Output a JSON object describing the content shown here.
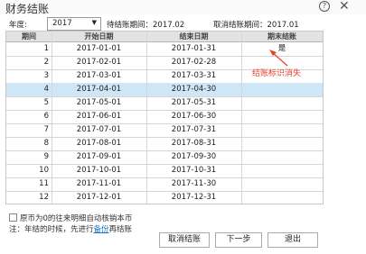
{
  "window": {
    "title": "财务结账"
  },
  "filter": {
    "year_label": "年度:",
    "year_value": "2017",
    "pending_label": "待结账期间：2017.02",
    "cancel_label": "取消结账期间：2017.01"
  },
  "table": {
    "columns": [
      "期间",
      "开始日期",
      "结束日期",
      "期末结账"
    ],
    "rows": [
      {
        "period": "1",
        "start": "2017-01-01",
        "end": "2017-01-31",
        "closed": "是"
      },
      {
        "period": "2",
        "start": "2017-02-01",
        "end": "2017-02-28",
        "closed": ""
      },
      {
        "period": "3",
        "start": "2017-03-01",
        "end": "2017-03-31",
        "closed": ""
      },
      {
        "period": "4",
        "start": "2017-04-01",
        "end": "2017-04-30",
        "closed": ""
      },
      {
        "period": "5",
        "start": "2017-05-01",
        "end": "2017-05-31",
        "closed": ""
      },
      {
        "period": "6",
        "start": "2017-06-01",
        "end": "2017-06-30",
        "closed": ""
      },
      {
        "period": "7",
        "start": "2017-07-01",
        "end": "2017-07-31",
        "closed": ""
      },
      {
        "period": "8",
        "start": "2017-08-01",
        "end": "2017-08-31",
        "closed": ""
      },
      {
        "period": "9",
        "start": "2017-09-01",
        "end": "2017-09-30",
        "closed": ""
      },
      {
        "period": "10",
        "start": "2017-10-01",
        "end": "2017-10-31",
        "closed": ""
      },
      {
        "period": "11",
        "start": "2017-11-01",
        "end": "2017-11-30",
        "closed": ""
      },
      {
        "period": "12",
        "start": "2017-12-01",
        "end": "2017-12-31",
        "closed": ""
      }
    ],
    "selected_period": "4"
  },
  "annotation": {
    "text": "结账标识消失",
    "color": "#e8402a"
  },
  "options": {
    "checkbox_label": "原币为0的往来明细自动核销本币",
    "note_prefix": "注：年结的时候，先进行",
    "note_link": "备份",
    "note_suffix": "再结账"
  },
  "buttons": {
    "cancel_close": "取消结账",
    "next_step": "下一步",
    "exit": "退出"
  },
  "colors": {
    "selected_row": "#cfe6f7",
    "header": "#e3e3e3",
    "link": "#1a73c7"
  }
}
